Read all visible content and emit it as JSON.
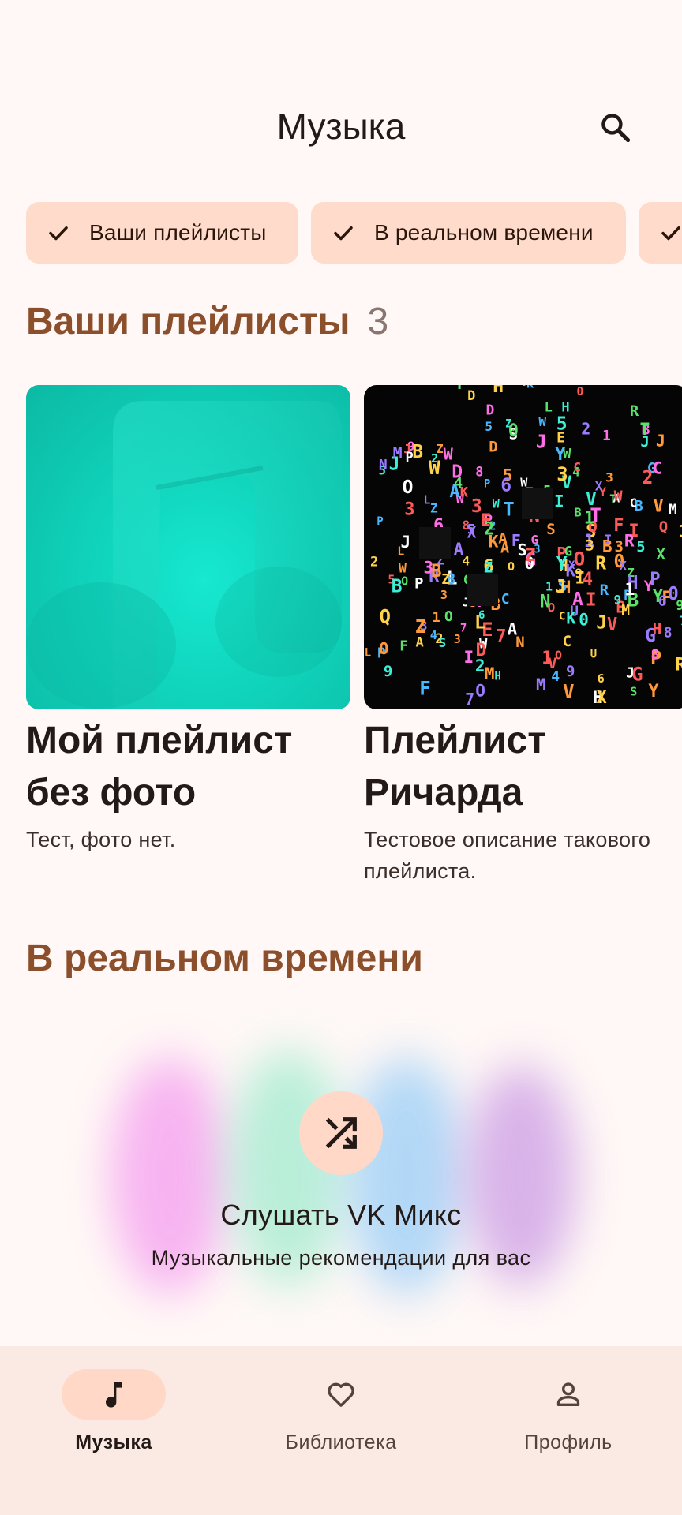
{
  "app_bar": {
    "title": "Музыка",
    "search_icon": "search-icon"
  },
  "filters": [
    {
      "label": "Ваши плейлисты",
      "selected": true
    },
    {
      "label": "В реальном времени",
      "selected": true
    },
    {
      "label": "",
      "selected": true
    }
  ],
  "playlists_section": {
    "title": "Ваши плейлисты",
    "count": "3",
    "items": [
      {
        "title": "Мой плейлист без фото",
        "description": "Тест, фото нет.",
        "cover": "music-note-placeholder"
      },
      {
        "title": "Плейлист Ричарда",
        "description": "Тестовое описание такового плейлиста.",
        "cover": "colorful-letters-image"
      }
    ]
  },
  "realtime_section": {
    "title": "В реальном времени",
    "mix_icon": "shuffle-icon",
    "mix_title": "Слушать VK Микс",
    "mix_subtitle": "Музыкальные рекомендации для вас"
  },
  "bottom_nav": {
    "items": [
      {
        "label": "Музыка",
        "icon": "music-note-icon",
        "active": true
      },
      {
        "label": "Библиотека",
        "icon": "heart-icon",
        "active": false
      },
      {
        "label": "Профиль",
        "icon": "person-icon",
        "active": false
      }
    ]
  },
  "colors": {
    "background": "#fff8f6",
    "chip": "#ffdbcc",
    "section_title": "#8c4f2c",
    "nav_background": "#fbe9e3",
    "nav_indicator": "#ffd8c8"
  }
}
